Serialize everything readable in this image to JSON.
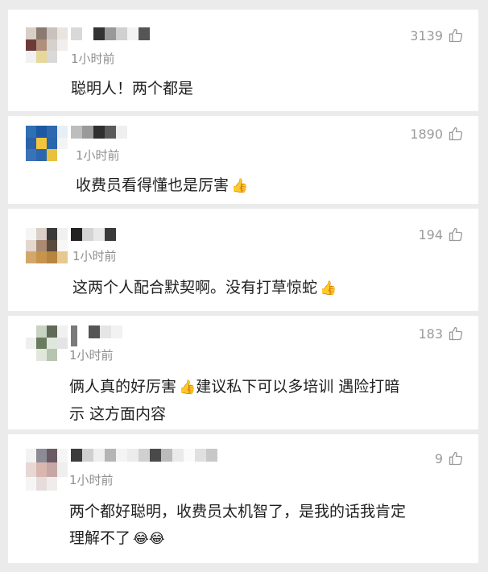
{
  "comments": [
    {
      "time": "1小时前",
      "likes": "3139",
      "text": "聪明人！两个都是",
      "emoji": ""
    },
    {
      "time": "1小时前",
      "likes": "1890",
      "text": "收费员看得懂也是厉害",
      "emoji": "👍"
    },
    {
      "time": "1小时前",
      "likes": "194",
      "text": "这两个人配合默契啊。没有打草惊蛇",
      "emoji": "👍"
    },
    {
      "time": "1小时前",
      "likes": "183",
      "text_line1": "俩人真的好厉害",
      "emoji_mid": "👍",
      "text_line1b": "建议私下可以多培训 遇险打暗",
      "text_line2": "示 这方面内容"
    },
    {
      "time": "1小时前",
      "likes": "9",
      "text_line1": "两个都好聪明，收费员太机智了，是我的话我肯定",
      "text_line2": "理解不了",
      "emoji": "😂😂"
    }
  ],
  "icons": {
    "like": "thumbs-up-outline-icon"
  }
}
